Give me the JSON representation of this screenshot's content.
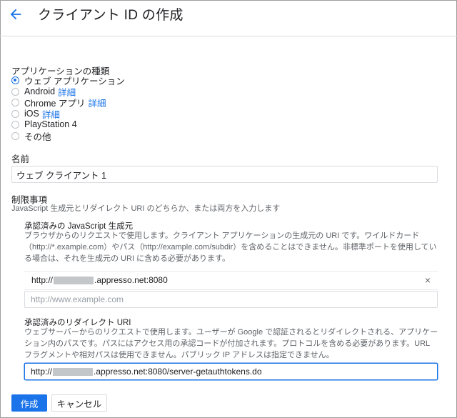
{
  "header": {
    "title": "クライアント ID の作成"
  },
  "app_type": {
    "label": "アプリケーションの種類",
    "options": [
      {
        "label": "ウェブ アプリケーション",
        "link": "",
        "checked": true
      },
      {
        "label": "Android",
        "link": "詳細",
        "checked": false
      },
      {
        "label": "Chrome アプリ",
        "link": "詳細",
        "checked": false
      },
      {
        "label": "iOS",
        "link": "詳細",
        "checked": false
      },
      {
        "label": "PlayStation 4",
        "link": "",
        "checked": false
      },
      {
        "label": "その他",
        "link": "",
        "checked": false
      }
    ]
  },
  "name": {
    "label": "名前",
    "value": "ウェブ クライアント 1"
  },
  "restrictions": {
    "title": "制限事項",
    "description": "JavaScript 生成元とリダイレクト URI のどちらか、または両方を入力します"
  },
  "js_origins": {
    "title": "承認済みの JavaScript 生成元",
    "desc_lines": [
      "ブラウザからのリクエストで使用します。クライアント アプリケーションの生成元の URI です。ワイルドカード",
      "（http://*.example.com）やパス（http://example.com/subdir）を含めることはできません。非標準ポートを使用してい",
      "る場合は、それを生成元の URI に含める必要があります。"
    ],
    "entry_prefix": "http://",
    "entry_suffix": ".appresso.net:8080",
    "remove_symbol": "×",
    "placeholder": "http://www.example.com"
  },
  "redirect_uris": {
    "title": "承認済みのリダイレクト URI",
    "desc_lines": [
      "ウェブサーバーからのリクエストで使用します。ユーザーが Google で認証されるとリダイレクトされる、アプリケー",
      "ション内のパスです。パスにはアクセス用の承認コードが付加されます。プロトコルを含める必要があります。URL",
      "フラグメントや相対パスは使用できません。パブリック IP アドレスは指定できません。"
    ],
    "value_prefix": "http://",
    "value_suffix": ".appresso.net:8080/server-getauthtokens.do"
  },
  "buttons": {
    "create": "作成",
    "cancel": "キャンセル"
  },
  "colors": {
    "accent": "#1a73e8",
    "text": "#202124",
    "muted": "#5f6368",
    "border": "#dadce0"
  }
}
